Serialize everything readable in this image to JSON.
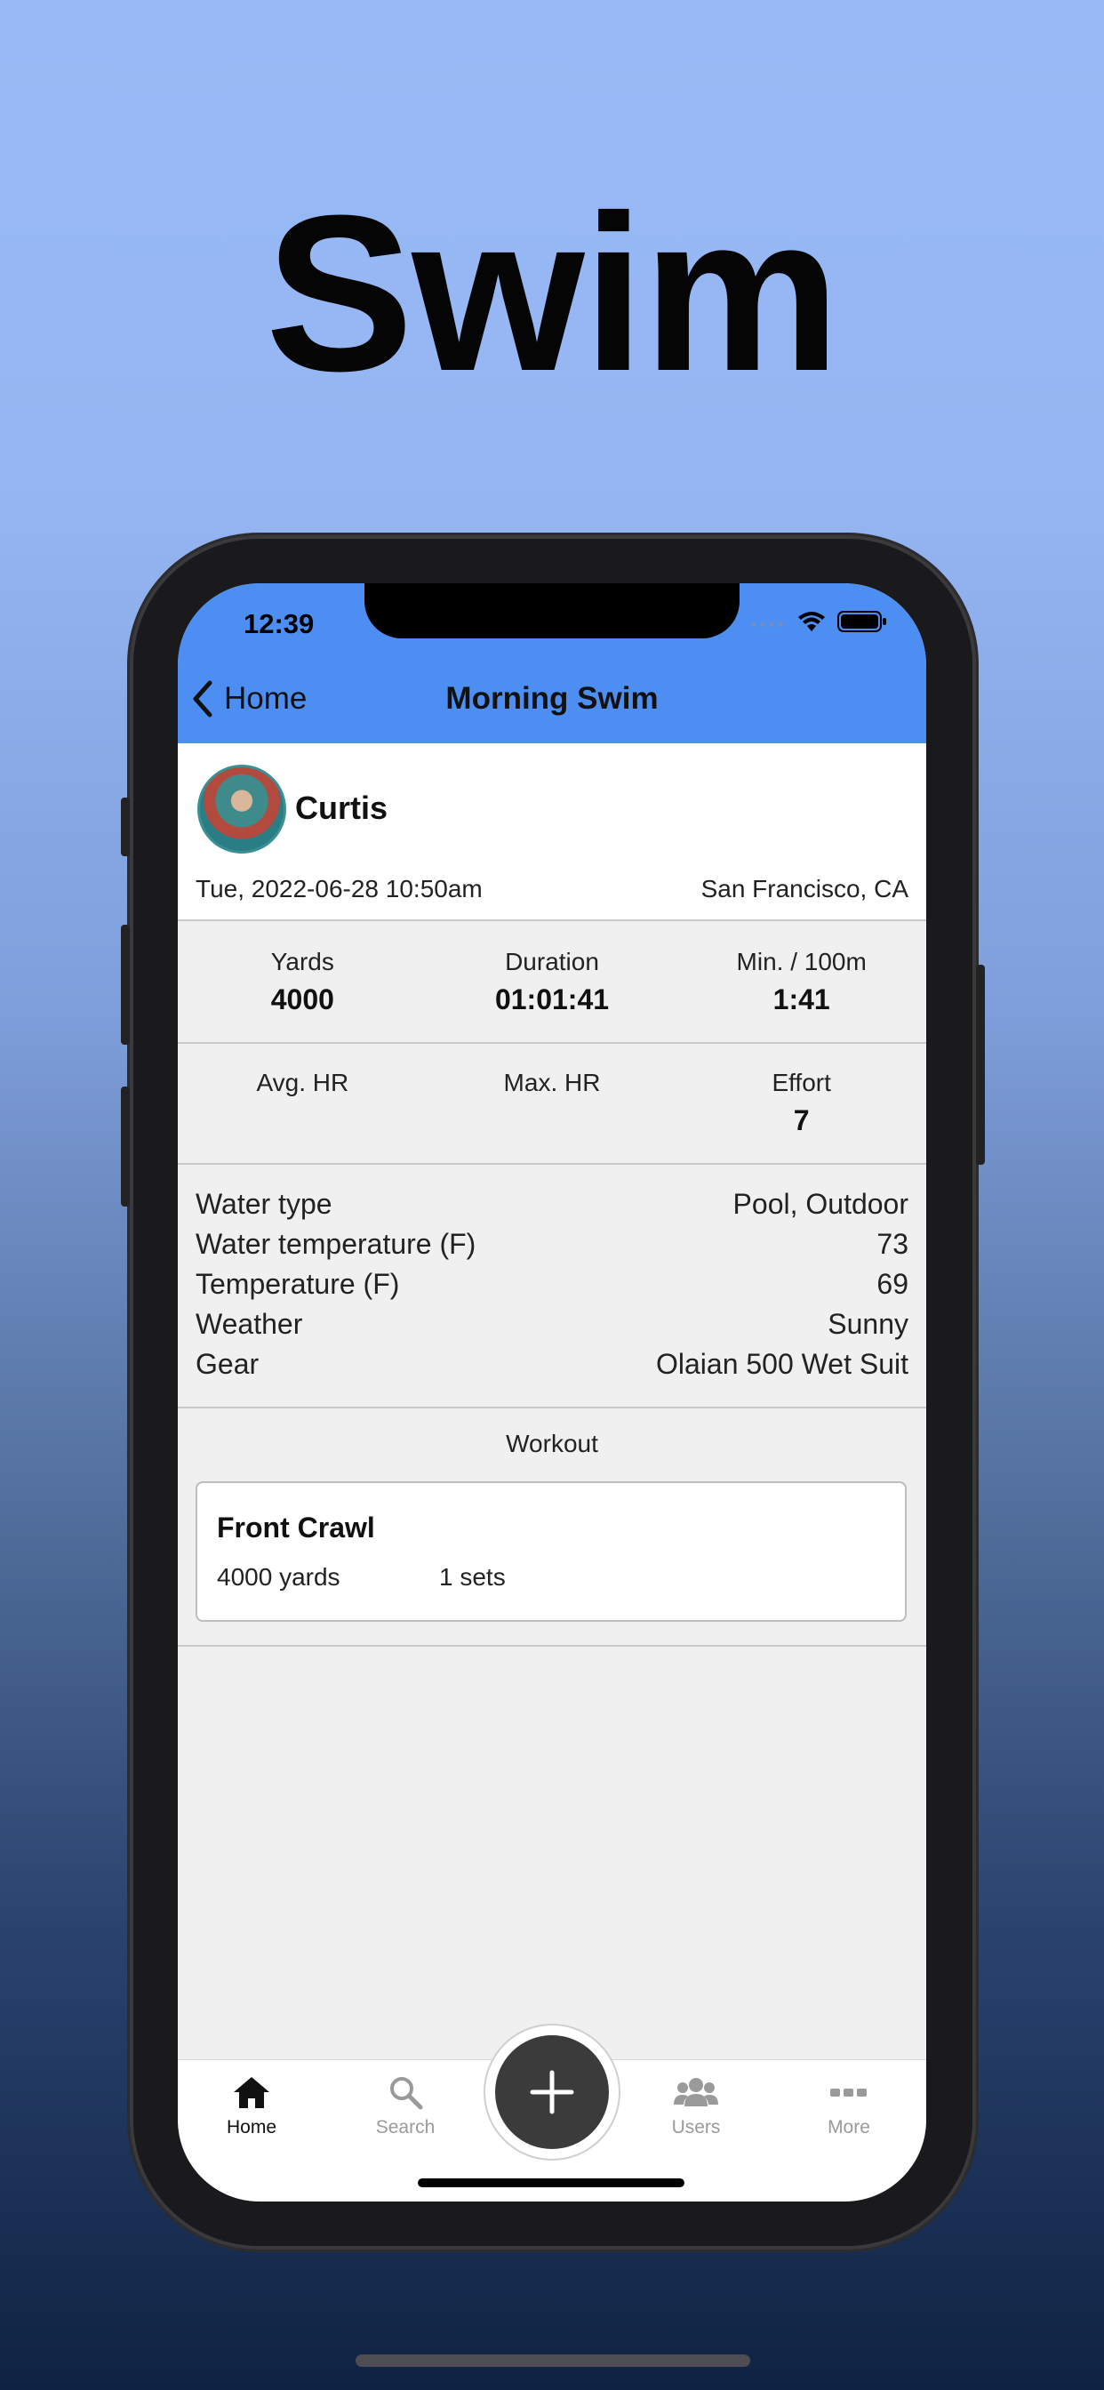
{
  "headline": "Swim",
  "status_bar": {
    "time": "12:39"
  },
  "nav": {
    "back_label": "Home",
    "title": "Morning Swim"
  },
  "post": {
    "user_name": "Curtis",
    "date": "Tue, 2022-06-28 10:50am",
    "location": "San Francisco, CA"
  },
  "stats_row1": [
    {
      "label": "Yards",
      "value": "4000"
    },
    {
      "label": "Duration",
      "value": "01:01:41"
    },
    {
      "label": "Min. / 100m",
      "value": "1:41"
    }
  ],
  "stats_row2": [
    {
      "label": "Avg. HR",
      "value": ""
    },
    {
      "label": "Max. HR",
      "value": ""
    },
    {
      "label": "Effort",
      "value": "7"
    }
  ],
  "details": [
    {
      "label": "Water type",
      "value": "Pool, Outdoor"
    },
    {
      "label": "Water temperature (F)",
      "value": "73"
    },
    {
      "label": "Temperature (F)",
      "value": "69"
    },
    {
      "label": "Weather",
      "value": "Sunny"
    },
    {
      "label": "Gear",
      "value": "Olaian 500 Wet Suit"
    }
  ],
  "workout": {
    "header": "Workout",
    "items": [
      {
        "name": "Front Crawl",
        "yards": "4000 yards",
        "sets": "1 sets"
      }
    ]
  },
  "tabbar": {
    "items": [
      {
        "label": "Home",
        "icon": "home-icon",
        "active": true
      },
      {
        "label": "Search",
        "icon": "search-icon",
        "active": false
      },
      {
        "label": "Users",
        "icon": "users-icon",
        "active": false
      },
      {
        "label": "More",
        "icon": "more-icon",
        "active": false
      }
    ],
    "add_icon": "plus-icon"
  },
  "colors": {
    "accent": "#4d8ef2",
    "tab_active": "#111111",
    "tab_inactive": "#9a9a9a",
    "fab": "#3b3b3b"
  }
}
